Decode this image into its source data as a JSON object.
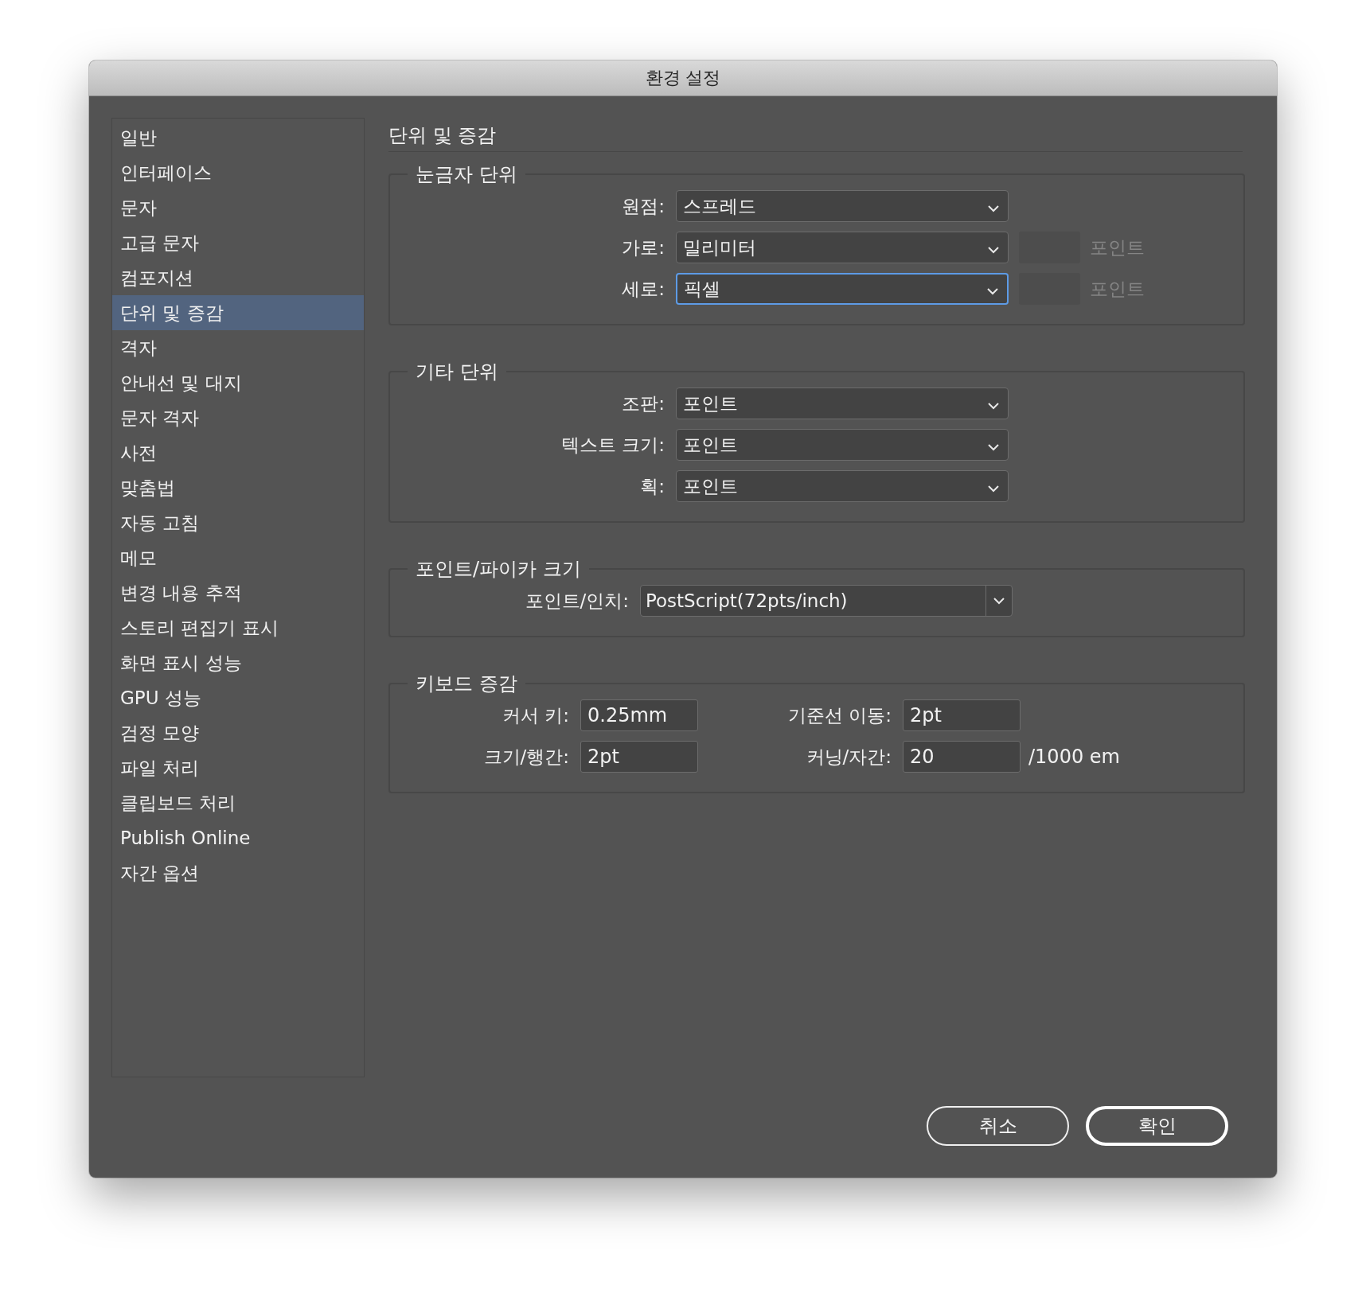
{
  "window": {
    "title": "환경 설정"
  },
  "sidebar": {
    "items": [
      {
        "label": "일반",
        "selected": false
      },
      {
        "label": "인터페이스",
        "selected": false
      },
      {
        "label": "문자",
        "selected": false
      },
      {
        "label": "고급 문자",
        "selected": false
      },
      {
        "label": "컴포지션",
        "selected": false
      },
      {
        "label": "단위 및 증감",
        "selected": true
      },
      {
        "label": "격자",
        "selected": false
      },
      {
        "label": "안내선 및 대지",
        "selected": false
      },
      {
        "label": "문자 격자",
        "selected": false
      },
      {
        "label": "사전",
        "selected": false
      },
      {
        "label": "맞춤법",
        "selected": false
      },
      {
        "label": "자동 고침",
        "selected": false
      },
      {
        "label": "메모",
        "selected": false
      },
      {
        "label": "변경 내용 추적",
        "selected": false
      },
      {
        "label": "스토리 편집기 표시",
        "selected": false
      },
      {
        "label": "화면 표시 성능",
        "selected": false
      },
      {
        "label": "GPU 성능",
        "selected": false
      },
      {
        "label": "검정 모양",
        "selected": false
      },
      {
        "label": "파일 처리",
        "selected": false
      },
      {
        "label": "클립보드 처리",
        "selected": false
      },
      {
        "label": "Publish Online",
        "selected": false
      },
      {
        "label": "자간 옵션",
        "selected": false
      }
    ]
  },
  "panel": {
    "title": "단위 및 증감",
    "groups": [
      {
        "title": "눈금자 단위",
        "rows": [
          {
            "kind": "select",
            "label": "원점:",
            "value": "스프레드",
            "focused": false
          },
          {
            "kind": "select",
            "label": "가로:",
            "value": "밀리미터",
            "focused": false,
            "side_field": {
              "unit": "포인트",
              "disabled": true
            }
          },
          {
            "kind": "select",
            "label": "세로:",
            "value": "픽셀",
            "focused": true,
            "side_field": {
              "unit": "포인트",
              "disabled": true
            }
          }
        ]
      },
      {
        "title": "기타 단위",
        "rows": [
          {
            "kind": "select",
            "label": "조판:",
            "value": "포인트",
            "focused": false
          },
          {
            "kind": "select",
            "label": "텍스트 크기:",
            "value": "포인트",
            "focused": false
          },
          {
            "kind": "select",
            "label": "획:",
            "value": "포인트",
            "focused": false
          }
        ]
      },
      {
        "title": "포인트/파이카 크기",
        "rows": [
          {
            "kind": "combo",
            "label": "포인트/인치:",
            "value": "PostScript(72pts/inch)",
            "focused": false
          }
        ]
      },
      {
        "title": "키보드 증감",
        "rows": [
          {
            "kind": "fields",
            "fields": [
              {
                "label": "커서 키:",
                "value": "0.25mm"
              },
              {
                "label": "기준선 이동:",
                "value": "2pt"
              }
            ]
          },
          {
            "kind": "fields",
            "fields": [
              {
                "label": "크기/행간:",
                "value": "2pt"
              },
              {
                "label": "커닝/자간:",
                "value": "20"
              }
            ],
            "suffix": "/1000 em"
          }
        ]
      }
    ]
  },
  "buttons": [
    {
      "label": "취소",
      "default": false
    },
    {
      "label": "확인",
      "default": true
    }
  ]
}
